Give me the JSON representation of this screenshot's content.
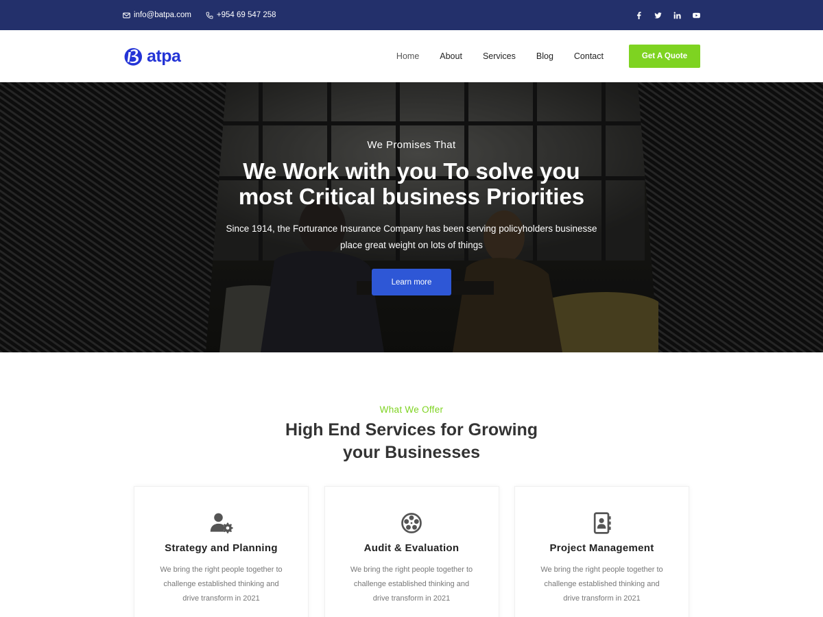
{
  "topbar": {
    "email": "info@batpa.com",
    "phone": "+954 69 547 258",
    "social": [
      "facebook-icon",
      "twitter-icon",
      "linkedin-icon",
      "youtube-icon"
    ]
  },
  "nav": {
    "logo_text": "atpa",
    "items": [
      {
        "label": "Home",
        "active": true
      },
      {
        "label": "About",
        "active": false
      },
      {
        "label": "Services",
        "active": false
      },
      {
        "label": "Blog",
        "active": false
      },
      {
        "label": "Contact",
        "active": false
      }
    ],
    "quote_label": "Get A Quote"
  },
  "hero": {
    "eyebrow": "We Promises That",
    "title_line1": "We Work with you To solve you",
    "title_line2": "most Critical business Priorities",
    "text_line1": "Since 1914, the Forturance Insurance Company has been serving policyholders businesse",
    "text_line2": "place great weight on lots of things",
    "button_label": "Learn more"
  },
  "services": {
    "eyebrow": "What We Offer",
    "title_line1": "High End Services for Growing",
    "title_line2": "your Businesses",
    "cards": [
      {
        "icon": "user-gear-icon",
        "title": "Strategy and Planning",
        "desc": "We bring the right people together to challenge established thinking and drive transform in 2021"
      },
      {
        "icon": "film-reel-icon",
        "title": "Audit & Evaluation",
        "desc": "We bring the right people together to challenge established thinking and drive transform in 2021"
      },
      {
        "icon": "address-book-icon",
        "title": "Project Management",
        "desc": "We bring the right people together to challenge established thinking and drive transform in 2021"
      }
    ]
  },
  "colors": {
    "topbar": "#23306b",
    "brand": "#2434d6",
    "accent_green": "#7ed321",
    "hero_button": "#2e57d6"
  }
}
